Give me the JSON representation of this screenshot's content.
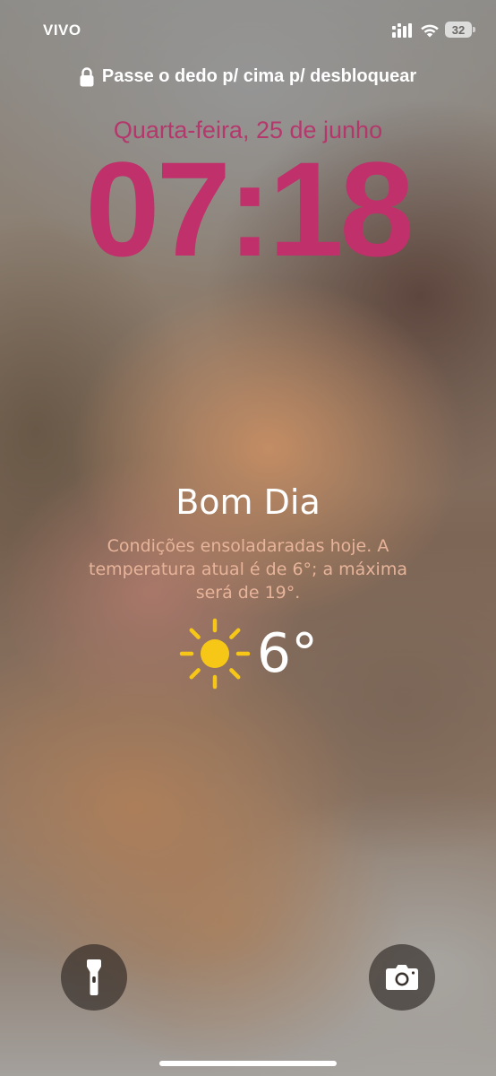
{
  "status_bar": {
    "carrier": "VIVO",
    "signal_icon": "signal-bars-icon",
    "wifi_icon": "wifi-icon",
    "battery_level": "32"
  },
  "lock_screen": {
    "unlock_hint": "Passe o dedo p/ cima p/ desbloquear",
    "lock_icon": "lock-icon",
    "date": "Quarta-feira, 25 de junho",
    "time": "07:18"
  },
  "weather_widget": {
    "greeting": "Bom Dia",
    "forecast": "Condições ensoladaradas hoje. A temperatura atual é de 6°; a máxima será de 19°.",
    "condition_icon": "sun-icon",
    "temperature": "6°"
  },
  "quick_actions": {
    "flashlight_icon": "flashlight-icon",
    "camera_icon": "camera-icon"
  },
  "colors": {
    "clock": "#c0306a",
    "date": "#b8316a",
    "forecast_text": "#e7b49a",
    "sun": "#f7c718"
  }
}
